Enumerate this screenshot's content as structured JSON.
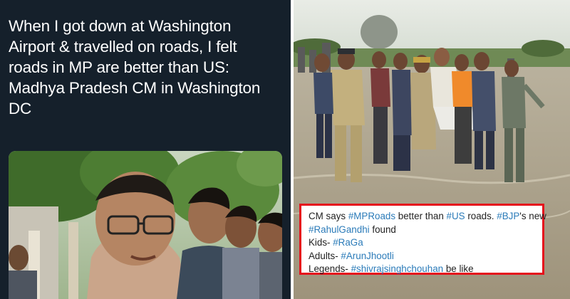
{
  "tweet": {
    "lines": [
      "When I got down at Washington",
      "Airport & travelled on roads, I felt",
      "roads in MP are better than US:",
      "Madhya Pradesh CM in Washington",
      "DC"
    ]
  },
  "caption": {
    "line1": {
      "a": "CM says ",
      "tag1": "#MPRoads",
      "b": " better than ",
      "tag2": "#US",
      "c": " roads. ",
      "tag3": "#BJP",
      "d": "'s new"
    },
    "line2": {
      "tag": "#RahulGandhi",
      "rest": " found"
    },
    "line3": {
      "label": "Kids- ",
      "tag": "#RaGa"
    },
    "line4": {
      "label": "Adults- ",
      "tag": "#ArunJhootli"
    },
    "line5": {
      "label": "Legends- ",
      "tag": "#shivrajsinghchouhan",
      "rest": " be like"
    }
  },
  "colors": {
    "tweet_bg": "#15202b",
    "hashtag": "#2b7bb9",
    "caption_border": "#e5101c"
  }
}
